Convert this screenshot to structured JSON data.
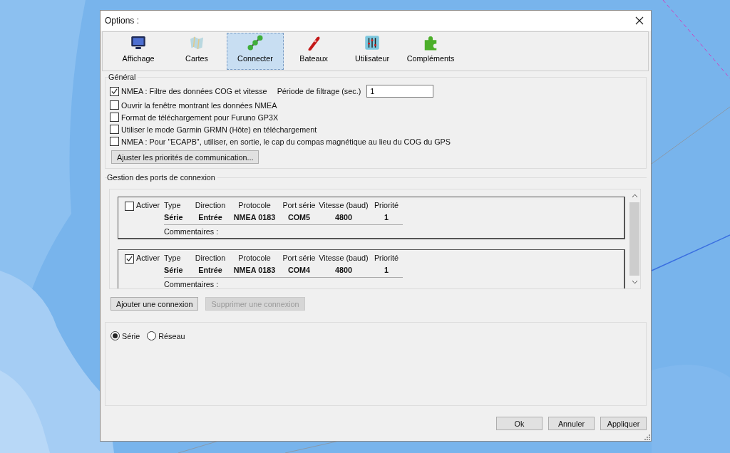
{
  "window": {
    "title": "Options :"
  },
  "tabs": [
    {
      "label": "Affichage",
      "selected": false
    },
    {
      "label": "Cartes",
      "selected": false
    },
    {
      "label": "Connecter",
      "selected": true
    },
    {
      "label": "Bateaux",
      "selected": false
    },
    {
      "label": "Utilisateur",
      "selected": false
    },
    {
      "label": "Compléments",
      "selected": false
    }
  ],
  "general": {
    "title": "Général",
    "options": [
      {
        "kind": "filter",
        "label": "NMEA : Filtre des données COG et vitesse",
        "checked": true,
        "field_label": "Période de filtrage (sec.)",
        "value": "1"
      },
      {
        "kind": "plain",
        "label": "Ouvrir la fenêtre montrant les données NMEA",
        "checked": false
      },
      {
        "kind": "plain",
        "label": "Format de téléchargement pour Furuno GP3X",
        "checked": false
      },
      {
        "kind": "plain",
        "label": "Utiliser le mode Garmin GRMN (Hôte) en téléchargement",
        "checked": false
      },
      {
        "kind": "plain",
        "label": "NMEA : Pour \"ECAPB\", utiliser, en sortie, le cap du compas magnétique  au lieu du COG du GPS",
        "checked": false
      }
    ],
    "button": "Ajuster les priorités de communication..."
  },
  "ports": {
    "title": "Gestion des ports de connexion",
    "connections": [
      {
        "enable_label": "Activer",
        "enabled": false,
        "columns": [
          "Type",
          "Direction",
          "Protocole",
          "Port série",
          "Vitesse (baud)",
          "Priorité"
        ],
        "values": [
          "Série",
          "Entrée",
          "NMEA 0183",
          "COM5",
          "4800",
          "1"
        ],
        "comment_label": "Commentaires :"
      },
      {
        "enable_label": "Activer",
        "enabled": true,
        "columns": [
          "Type",
          "Direction",
          "Protocole",
          "Port série",
          "Vitesse (baud)",
          "Priorité"
        ],
        "values": [
          "Série",
          "Entrée",
          "NMEA 0183",
          "COM4",
          "4800",
          "1"
        ],
        "comment_label": "Commentaires :"
      }
    ],
    "buttons": [
      {
        "label": "Ajouter une connexion",
        "disabled": false
      },
      {
        "label": "Supprimer une connexion",
        "disabled": true
      }
    ]
  },
  "mode": [
    {
      "label": "Série",
      "selected": true
    },
    {
      "label": "Réseau",
      "selected": false
    }
  ],
  "footer_buttons": [
    "Ok",
    "Annuler",
    "Appliquer"
  ]
}
